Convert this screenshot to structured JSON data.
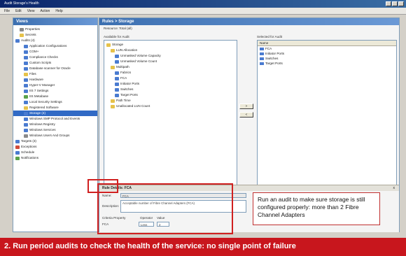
{
  "window": {
    "title": "Audit Storage's Health"
  },
  "menu": [
    "File",
    "Edit",
    "View",
    "Action",
    "Help"
  ],
  "left_pane": {
    "title": "Views",
    "items": [
      {
        "label": "Properties",
        "indent": 1,
        "icon": "gray"
      },
      {
        "label": "Secrets",
        "indent": 1,
        "icon": "yellow"
      },
      {
        "label": "Audits (4)",
        "indent": 0,
        "icon": "blue"
      },
      {
        "label": "Application Configurations",
        "indent": 2,
        "icon": "blue"
      },
      {
        "label": "COM+",
        "indent": 2,
        "icon": "blue"
      },
      {
        "label": "Compliance Checks",
        "indent": 2,
        "icon": "blue"
      },
      {
        "label": "Custom Scripts",
        "indent": 2,
        "icon": "blue"
      },
      {
        "label": "Database scanner for Oracle",
        "indent": 2,
        "icon": "blue"
      },
      {
        "label": "Files",
        "indent": 2,
        "icon": "yellow"
      },
      {
        "label": "Hardware",
        "indent": 2,
        "icon": "blue"
      },
      {
        "label": "Hyper-V Manager",
        "indent": 2,
        "icon": "blue"
      },
      {
        "label": "IIS 7 Settings",
        "indent": 2,
        "icon": "blue"
      },
      {
        "label": "IIS Metabase",
        "indent": 2,
        "icon": "green"
      },
      {
        "label": "Local Security Settings",
        "indent": 2,
        "icon": "blue"
      },
      {
        "label": "Registered Software",
        "indent": 2,
        "icon": "yellow"
      },
      {
        "label": "Storage (4)",
        "indent": 2,
        "icon": "blue",
        "selected": true
      },
      {
        "label": "Windows SMP Protocol and Events",
        "indent": 2,
        "icon": "blue"
      },
      {
        "label": "Windows Registry",
        "indent": 2,
        "icon": "blue"
      },
      {
        "label": "Windows Services",
        "indent": 2,
        "icon": "blue"
      },
      {
        "label": "Windows Users And Groups",
        "indent": 2,
        "icon": "gray"
      },
      {
        "label": "Targets (3)",
        "indent": 0,
        "icon": "blue"
      },
      {
        "label": "Exceptions",
        "indent": 0,
        "icon": "red"
      },
      {
        "label": "Schedule",
        "indent": 0,
        "icon": "blue"
      },
      {
        "label": "Notifications",
        "indent": 0,
        "icon": "green"
      }
    ]
  },
  "right_pane": {
    "title": "Rules > Storage",
    "resource": "Resource: Total (all)",
    "available_label": "Available for Audit",
    "selected_label": "Selected for Audit",
    "available_items": [
      {
        "label": "Storage",
        "indent": 0
      },
      {
        "label": "LUN Allocation",
        "indent": 1
      },
      {
        "label": "Unmasked Volume Capacity",
        "indent": 2
      },
      {
        "label": "Unmasked Volume Count",
        "indent": 2
      },
      {
        "label": "Multipath",
        "indent": 1
      },
      {
        "label": "Fabrics",
        "indent": 2
      },
      {
        "label": "FCA",
        "indent": 2
      },
      {
        "label": "Initiator Ports",
        "indent": 2
      },
      {
        "label": "Switches",
        "indent": 2
      },
      {
        "label": "Target Ports",
        "indent": 2
      },
      {
        "label": "Path Time",
        "indent": 1
      },
      {
        "label": "Unallocated LUN Count",
        "indent": 1
      }
    ],
    "selected_header": "Name",
    "selected_items": [
      "FCA",
      "Initiator Ports",
      "Switches",
      "Target Ports"
    ],
    "add_button": ">",
    "remove_button": "<"
  },
  "details": {
    "title": "Rule Details: FCA",
    "close": "x",
    "name_label": "Name:",
    "name_value": "FCA",
    "description_label": "Description:",
    "description_value": "Acceptable number of Fibre Channel Adapters (FCA)",
    "criteria_headers": [
      "Criteria Property",
      "Operator",
      "Value"
    ],
    "criteria_row": [
      "FCA",
      "Less",
      "2"
    ]
  },
  "callout": "Run an audit to make sure storage is still configured properly: more than 2 Fibre Channel Adapters",
  "banner": "2. Run period audits to check the health of the service: no single point of failure",
  "colors": {
    "banner": "#c8161d",
    "highlight": "#d02020",
    "selection": "#316ac5"
  }
}
